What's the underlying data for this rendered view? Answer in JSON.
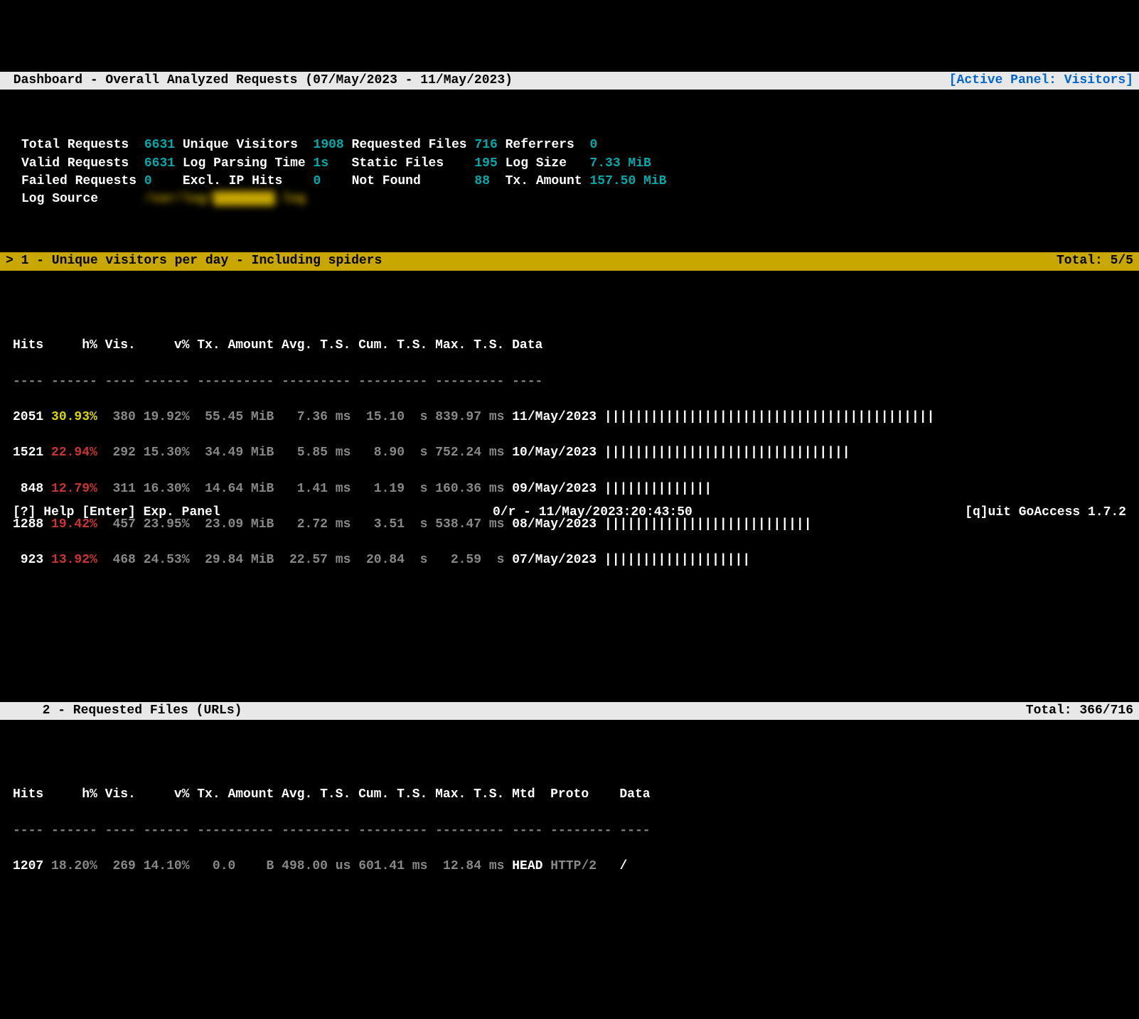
{
  "header": {
    "title": " Dashboard - Overall Analyzed Requests (07/May/2023 - 11/May/2023)",
    "active_panel": "[Active Panel: Visitors]"
  },
  "summary": {
    "total_requests_label": "Total Requests",
    "total_requests": "6631",
    "unique_visitors_label": "Unique Visitors",
    "unique_visitors": "1908",
    "requested_files_label": "Requested Files",
    "requested_files": "716",
    "referrers_label": "Referrers",
    "referrers": "0",
    "valid_requests_label": "Valid Requests",
    "valid_requests": "6631",
    "log_parsing_time_label": "Log Parsing Time",
    "log_parsing_time": "1s",
    "static_files_label": "Static Files",
    "static_files": "195",
    "log_size_label": "Log Size",
    "log_size": "7.33 MiB",
    "failed_requests_label": "Failed Requests",
    "failed_requests": "0",
    "excl_ip_hits_label": "Excl. IP Hits",
    "excl_ip_hits": "0",
    "not_found_label": "Not Found",
    "not_found": "88",
    "tx_amount_label": "Tx. Amount",
    "tx_amount": "157.50 MiB",
    "log_source_label": "Log Source",
    "log_source": "/var/log/████████.log"
  },
  "panel1": {
    "title": "> 1 - Unique visitors per day - Including spiders",
    "total": "Total: 5/5",
    "columns": "Hits     h% Vis.     v% Tx. Amount Avg. T.S. Cum. T.S. Max. T.S. Data",
    "separator": "---- ------ ---- ------ ---------- --------- --------- --------- ----",
    "rows": [
      {
        "hits": "2051",
        "hpct": "30.93%",
        "vis": " 380",
        "vpct": "19.92%",
        "tx": " 55.45 MiB",
        "avg": "  7.36 ms",
        "cum": " 15.10  s",
        "max": "839.97 ms",
        "date": "11/May/2023",
        "bar": "|||||||||||||||||||||||||||||||||||||||||||"
      },
      {
        "hits": "1521",
        "hpct": "22.94%",
        "vis": " 292",
        "vpct": "15.30%",
        "tx": " 34.49 MiB",
        "avg": "  5.85 ms",
        "cum": "  8.90  s",
        "max": "752.24 ms",
        "date": "10/May/2023",
        "bar": "||||||||||||||||||||||||||||||||"
      },
      {
        "hits": " 848",
        "hpct": "12.79%",
        "vis": " 311",
        "vpct": "16.30%",
        "tx": " 14.64 MiB",
        "avg": "  1.41 ms",
        "cum": "  1.19  s",
        "max": "160.36 ms",
        "date": "09/May/2023",
        "bar": "||||||||||||||"
      },
      {
        "hits": "1288",
        "hpct": "19.42%",
        "vis": " 457",
        "vpct": "23.95%",
        "tx": " 23.09 MiB",
        "avg": "  2.72 ms",
        "cum": "  3.51  s",
        "max": "538.47 ms",
        "date": "08/May/2023",
        "bar": "|||||||||||||||||||||||||||"
      },
      {
        "hits": " 923",
        "hpct": "13.92%",
        "vis": " 468",
        "vpct": "24.53%",
        "tx": " 29.84 MiB",
        "avg": " 22.57 ms",
        "cum": " 20.84  s",
        "max": "  2.59  s",
        "date": "07/May/2023",
        "bar": "|||||||||||||||||||"
      }
    ]
  },
  "panel2": {
    "title": "  2 - Requested Files (URLs)",
    "total": "Total: 366/716",
    "columns": "Hits     h% Vis.     v% Tx. Amount Avg. T.S. Cum. T.S. Max. T.S. Mtd  Proto    Data",
    "separator": "---- ------ ---- ------ ---------- --------- --------- --------- ---- -------- ----",
    "rows": [
      {
        "hits": "1207",
        "hpct": "18.20%",
        "vis": " 269",
        "vpct": "14.10%",
        "tx": "  0.0    B",
        "avg": "498.00 us",
        "cum": "601.41 ms",
        "max": " 12.84 ms",
        "mtd": "HEAD",
        "proto": "HTTP/2",
        "data": "/"
      }
    ]
  },
  "footer": {
    "left": "[?] Help [Enter] Exp. Panel",
    "center": "0/r - 11/May/2023:20:43:50",
    "right": "[q]uit GoAccess 1.7.2"
  }
}
